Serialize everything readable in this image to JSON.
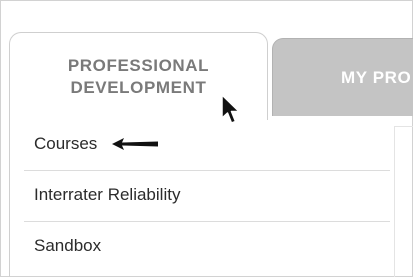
{
  "tabs": [
    {
      "label": "PROFESSIONAL\nDEVELOPMENT",
      "active": true
    },
    {
      "label": "MY PRO",
      "active": false
    }
  ],
  "menu": {
    "items": [
      {
        "label": "Courses"
      },
      {
        "label": "Interrater Reliability"
      },
      {
        "label": "Sandbox"
      }
    ]
  },
  "icons": {
    "pointer": "mouse-pointer-icon",
    "annotation": "left-arrow-icon"
  },
  "colors": {
    "active_tab_text": "#7a7a7a",
    "inactive_tab_bg": "#c4c4c4",
    "inactive_tab_text": "#ffffff",
    "menu_text": "#2b2b2b",
    "divider": "#dcdcdc"
  }
}
